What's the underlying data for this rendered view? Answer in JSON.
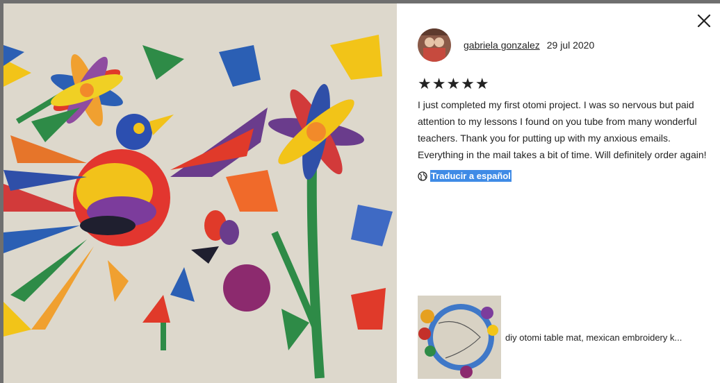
{
  "close": {
    "icon": "close-icon"
  },
  "review": {
    "reviewer_name": "gabriela gonzalez",
    "date": "29 jul 2020",
    "rating": 5,
    "stars": "★★★★★",
    "text": "I just completed my first otomi project. I was so nervous but paid attention to my lessons I found on you tube from many wonderful teachers. Thank you for putting up with my anxious emails. Everything in the mail takes a bit of time. Will definitely order again!",
    "translate_label": "Traducir a español",
    "translate_icon": "globe-icon"
  },
  "listing": {
    "title": "diy otomi table mat, mexican embroidery k..."
  },
  "colors": {
    "backdrop": "#6f6f6f",
    "selection": "#3f8be6",
    "text": "#222222"
  }
}
